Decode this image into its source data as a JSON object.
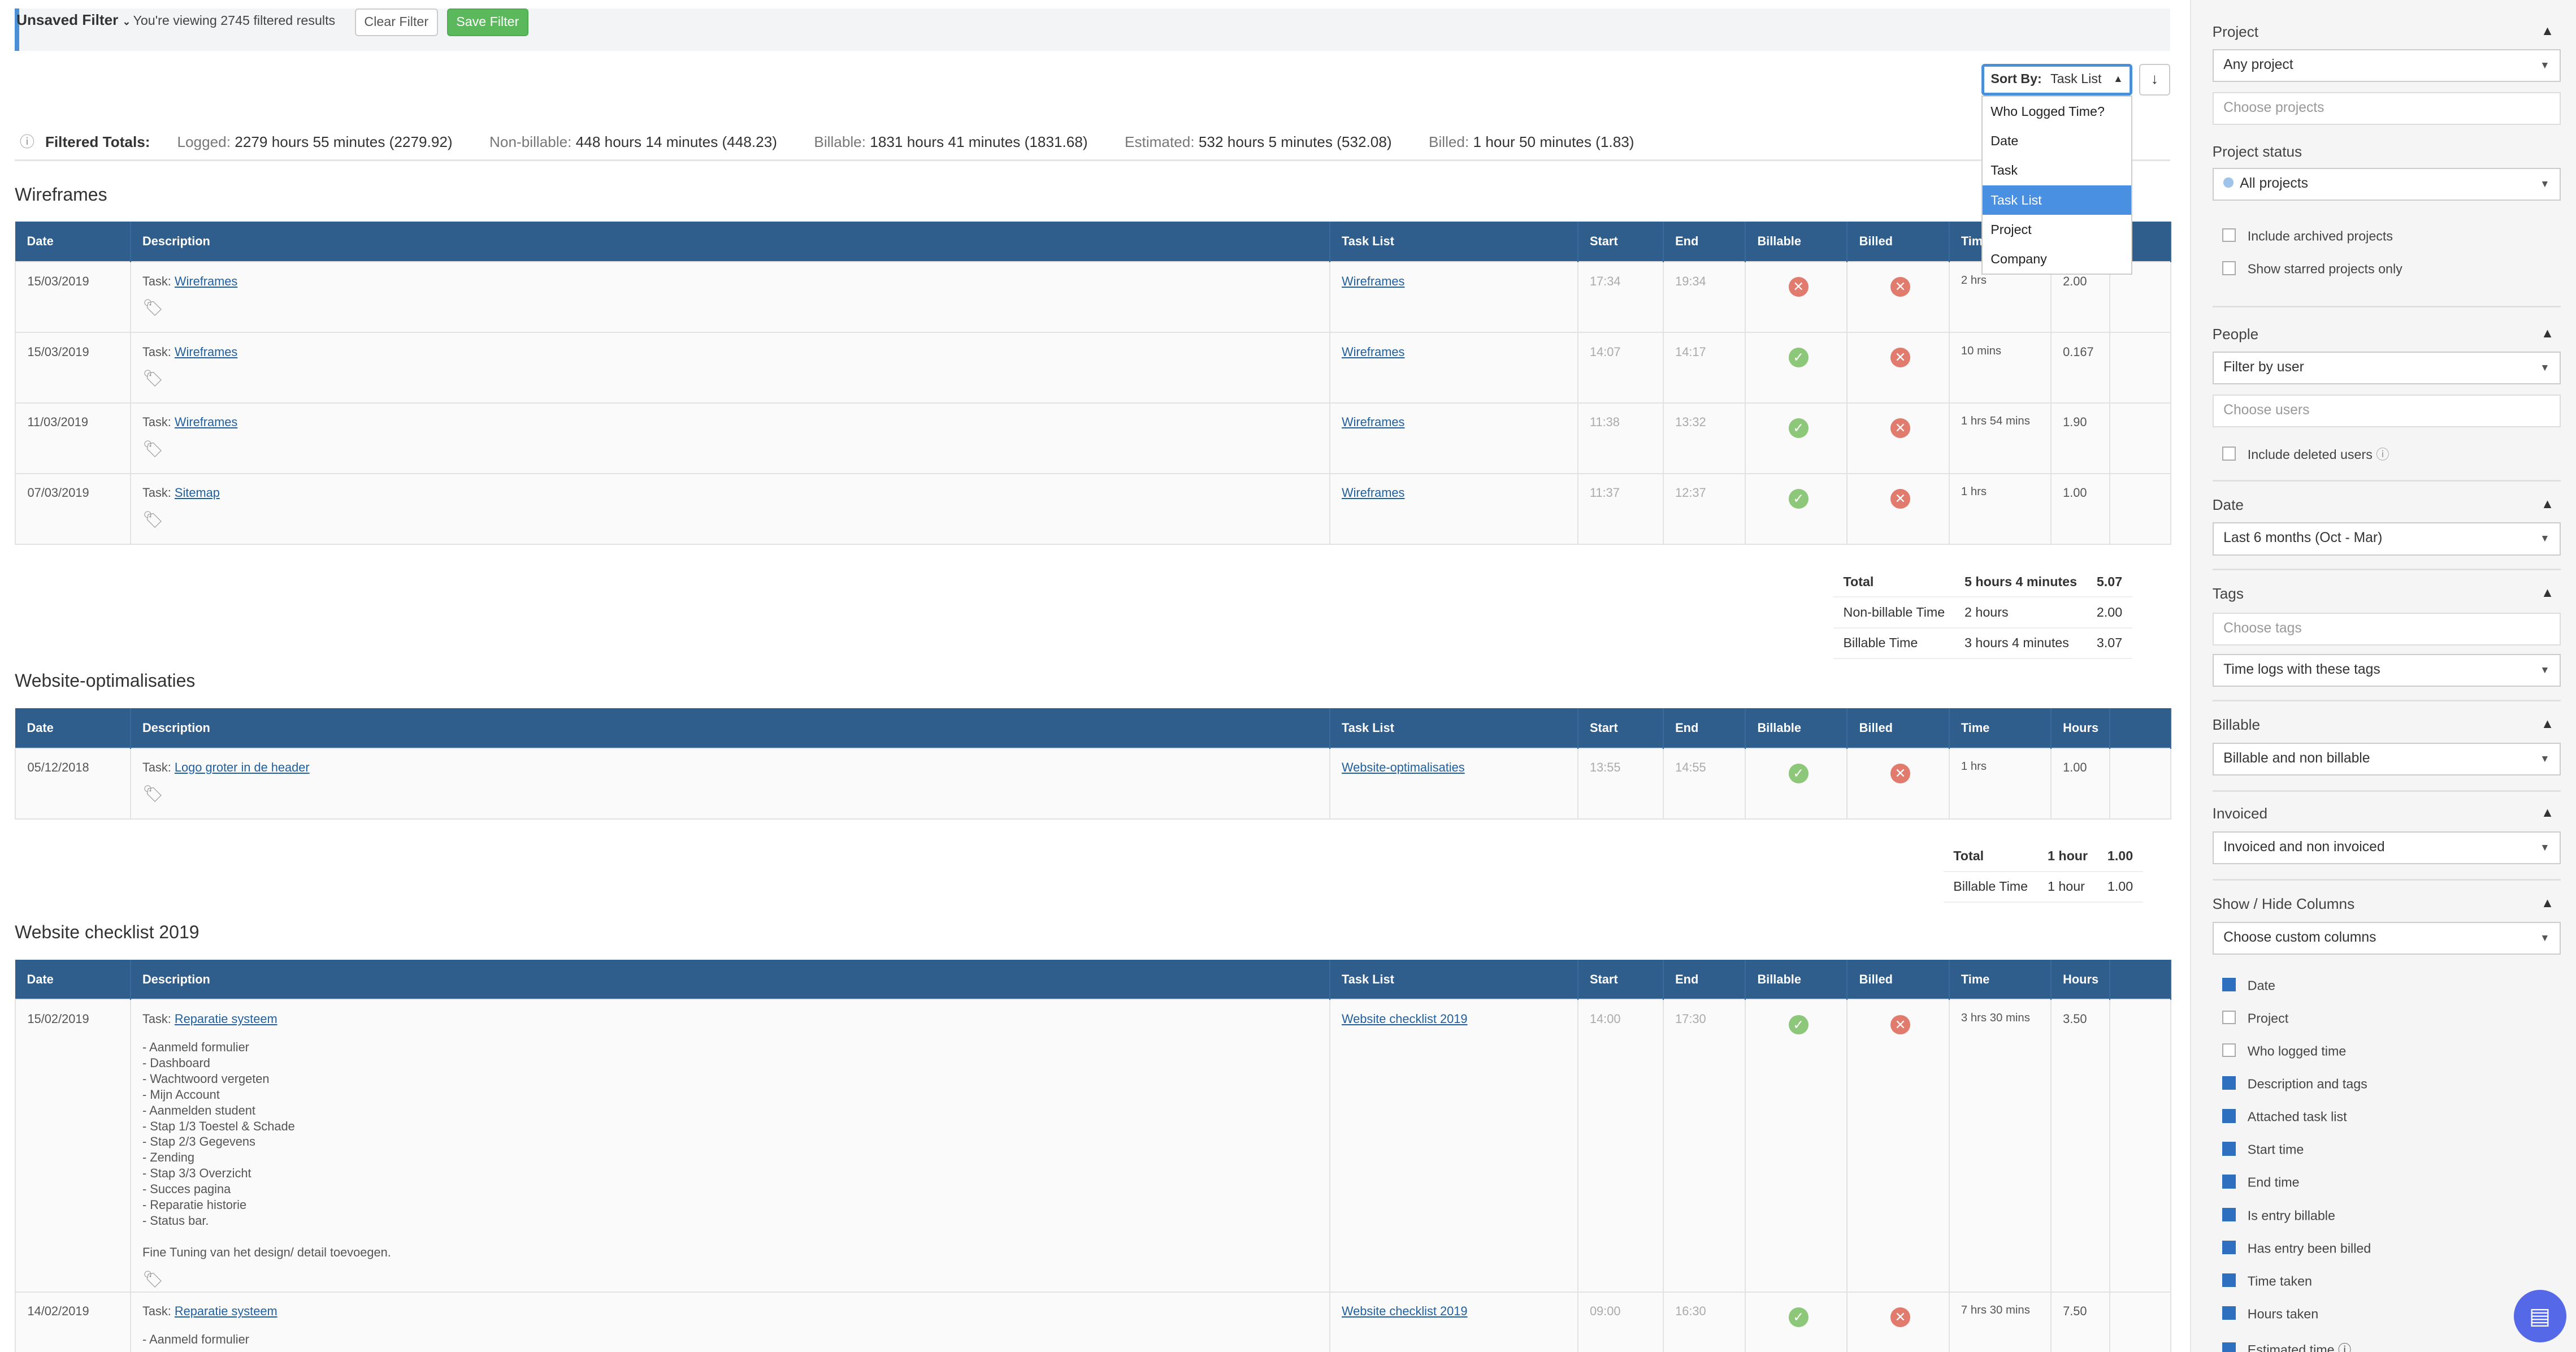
{
  "filter_bar": {
    "unsaved_label": "Unsaved Filter",
    "viewing_text": "You're viewing 2745 filtered results",
    "clear_label": "Clear Filter",
    "save_label": "Save Filter"
  },
  "sort": {
    "label": "Sort By:",
    "value": "Task List",
    "direction_icon": "↓",
    "options": [
      "Who Logged Time?",
      "Date",
      "Task",
      "Task List",
      "Project",
      "Company"
    ],
    "selected": "Task List"
  },
  "totals": {
    "title": "Filtered Totals:",
    "logged_label": "Logged:",
    "logged_value": "2279 hours 55 minutes (2279.92)",
    "nonbillable_label": "Non-billable:",
    "nonbillable_value": "448 hours 14 minutes (448.23)",
    "billable_label": "Billable:",
    "billable_value": "1831 hours 41 minutes (1831.68)",
    "estimated_label": "Estimated:",
    "estimated_value": "532 hours 5 minutes (532.08)",
    "billed_label": "Billed:",
    "billed_value": "1 hour 50 minutes (1.83)"
  },
  "columns": [
    "Date",
    "Description",
    "Task List",
    "Start",
    "End",
    "Billable",
    "Billed",
    "Time",
    "Hours"
  ],
  "task_prefix": "Task:",
  "sections": [
    {
      "title": "Wireframes",
      "rows": [
        {
          "date": "15/03/2019",
          "task": "Wireframes",
          "tasklist": "Wireframes",
          "start": "17:34",
          "end": "19:34",
          "billable": false,
          "billed": false,
          "time": "2 hrs",
          "hours": "2.00"
        },
        {
          "date": "15/03/2019",
          "task": "Wireframes",
          "tasklist": "Wireframes",
          "start": "14:07",
          "end": "14:17",
          "billable": true,
          "billed": false,
          "time": "10 mins",
          "hours": "0.167"
        },
        {
          "date": "11/03/2019",
          "task": "Wireframes",
          "tasklist": "Wireframes",
          "start": "11:38",
          "end": "13:32",
          "billable": true,
          "billed": false,
          "time": "1 hrs 54 mins",
          "hours": "1.90"
        },
        {
          "date": "07/03/2019",
          "task": "Sitemap",
          "tasklist": "Wireframes",
          "start": "11:37",
          "end": "12:37",
          "billable": true,
          "billed": false,
          "time": "1 hrs",
          "hours": "1.00"
        }
      ],
      "summary": [
        {
          "label": "Total",
          "time": "5 hours 4 minutes",
          "hours": "5.07"
        },
        {
          "label": "Non-billable Time",
          "time": "2 hours",
          "hours": "2.00"
        },
        {
          "label": "Billable Time",
          "time": "3 hours 4 minutes",
          "hours": "3.07"
        }
      ]
    },
    {
      "title": "Website-optimalisaties",
      "rows": [
        {
          "date": "05/12/2018",
          "task": "Logo groter in de header",
          "tasklist": "Website-optimalisaties",
          "start": "13:55",
          "end": "14:55",
          "billable": true,
          "billed": false,
          "time": "1 hrs",
          "hours": "1.00"
        }
      ],
      "summary": [
        {
          "label": "Total",
          "time": "1 hour",
          "hours": "1.00"
        },
        {
          "label": "Billable Time",
          "time": "1 hour",
          "hours": "1.00"
        }
      ]
    },
    {
      "title": "Website checklist 2019",
      "rows": [
        {
          "date": "15/02/2019",
          "task": "Reparatie systeem",
          "tasklist": "Website checklist 2019",
          "start": "14:00",
          "end": "17:30",
          "billable": true,
          "billed": false,
          "time": "3 hrs 30 mins",
          "hours": "3.50",
          "lines": [
            "- Aanmeld formulier",
            "- Dashboard",
            "- Wachtwoord vergeten",
            "- Mijn Account",
            "- Aanmelden student",
            "- Stap 1/3 Toestel & Schade",
            "- Stap 2/3 Gegevens",
            "- Zending",
            "- Stap 3/3 Overzicht",
            "- Succes pagina",
            "- Reparatie historie",
            "- Status bar.",
            "",
            "Fine Tuning van het design/ detail toevoegen."
          ]
        },
        {
          "date": "14/02/2019",
          "task": "Reparatie systeem",
          "tasklist": "Website checklist 2019",
          "start": "09:00",
          "end": "16:30",
          "billable": true,
          "billed": false,
          "time": "7 hrs 30 mins",
          "hours": "7.50",
          "lines": [
            "- Aanmeld formulier"
          ]
        }
      ]
    }
  ],
  "sidebar": {
    "project": {
      "heading": "Project",
      "select": "Any project",
      "input_placeholder": "Choose projects"
    },
    "project_status": {
      "heading": "Project status",
      "select": "All projects",
      "checks": [
        {
          "label": "Include archived projects",
          "on": false
        },
        {
          "label": "Show starred projects only",
          "on": false
        }
      ]
    },
    "people": {
      "heading": "People",
      "select": "Filter by user",
      "input_placeholder": "Choose users",
      "check": "Include deleted users"
    },
    "date": {
      "heading": "Date",
      "select": "Last 6 months (Oct - Mar)"
    },
    "tags": {
      "heading": "Tags",
      "input_placeholder": "Choose tags",
      "select": "Time logs with these tags"
    },
    "billable": {
      "heading": "Billable",
      "select": "Billable and non billable"
    },
    "invoiced": {
      "heading": "Invoiced",
      "select": "Invoiced and non invoiced"
    },
    "columns": {
      "heading": "Show / Hide Columns",
      "select": "Choose custom columns",
      "items": [
        {
          "label": "Date",
          "on": true
        },
        {
          "label": "Project",
          "on": false
        },
        {
          "label": "Who logged time",
          "on": false
        },
        {
          "label": "Description and tags",
          "on": true
        },
        {
          "label": "Attached task list",
          "on": true
        },
        {
          "label": "Start time",
          "on": true
        },
        {
          "label": "End time",
          "on": true
        },
        {
          "label": "Is entry billable",
          "on": true
        },
        {
          "label": "Has entry been billed",
          "on": true
        },
        {
          "label": "Time taken",
          "on": true
        },
        {
          "label": "Hours taken",
          "on": true
        },
        {
          "label": "Estimated time",
          "on": true
        }
      ]
    }
  },
  "colors": {
    "header_bg": "#2f5d8c",
    "accent": "#4a90d9",
    "save_green": "#5cb85c",
    "ok_green": "#8dc77a",
    "no_red": "#e07b6e",
    "help_button": "#5468e8"
  }
}
